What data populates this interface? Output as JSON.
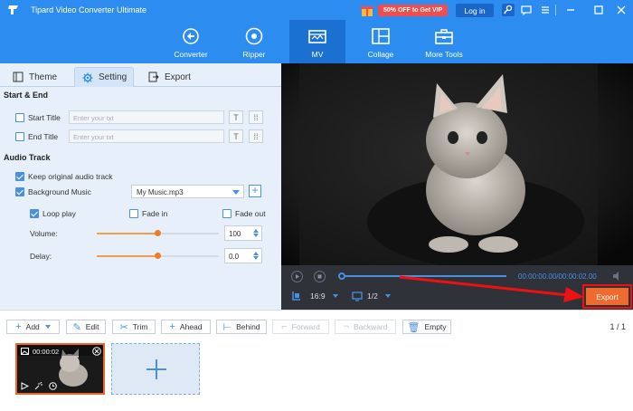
{
  "app": {
    "title": "Tipard Video Converter Ultimate",
    "promo": "50% OFF to Get VIP",
    "login_label": "Log in"
  },
  "nav": [
    {
      "label": "Converter",
      "icon": "converter-icon"
    },
    {
      "label": "Ripper",
      "icon": "ripper-icon"
    },
    {
      "label": "MV",
      "icon": "mv-icon",
      "active": true
    },
    {
      "label": "Collage",
      "icon": "collage-icon"
    },
    {
      "label": "More Tools",
      "icon": "toolbox-icon"
    }
  ],
  "subtabs": [
    {
      "label": "Theme",
      "icon": "theme-icon"
    },
    {
      "label": "Setting",
      "icon": "gear-icon",
      "active": true
    },
    {
      "label": "Export",
      "icon": "export-icon"
    }
  ],
  "start_end": {
    "heading": "Start & End",
    "start_title": {
      "label": "Start Title",
      "placeholder": "Enter your txt",
      "checked": false
    },
    "end_title": {
      "label": "End Title",
      "placeholder": "Enter your txt",
      "checked": false
    }
  },
  "audio": {
    "heading": "Audio Track",
    "keep_original": {
      "label": "Keep original audio track",
      "checked": true
    },
    "background_music": {
      "label": "Background Music",
      "checked": true,
      "file": "My Music.mp3"
    },
    "loop_play": {
      "label": "Loop play",
      "checked": true
    },
    "fade_in": {
      "label": "Fade in",
      "checked": false
    },
    "fade_out": {
      "label": "Fade out",
      "checked": false
    },
    "volume": {
      "label": "Volume:",
      "value": "100",
      "level": 0.5
    },
    "delay": {
      "label": "Delay:",
      "value": "0.0",
      "level": 0.5
    }
  },
  "player": {
    "time": "00:00:00.00/00:00:02.00",
    "progress": 0.0,
    "aspect_ratio": "16:9",
    "page": "1/2",
    "export_label": "Export"
  },
  "toolbar": {
    "add": "Add",
    "edit": "Edit",
    "trim": "Trim",
    "ahead": "Ahead",
    "behind": "Behind",
    "forward": "Forward",
    "backward": "Backward",
    "empty": "Empty",
    "page_count": "1 / 1"
  },
  "timeline": {
    "clip_duration": "00:00:02"
  },
  "colors": {
    "brand_blue": "#2d8cf0",
    "accent_orange": "#f06a2e",
    "highlight_red": "#ee1111"
  }
}
